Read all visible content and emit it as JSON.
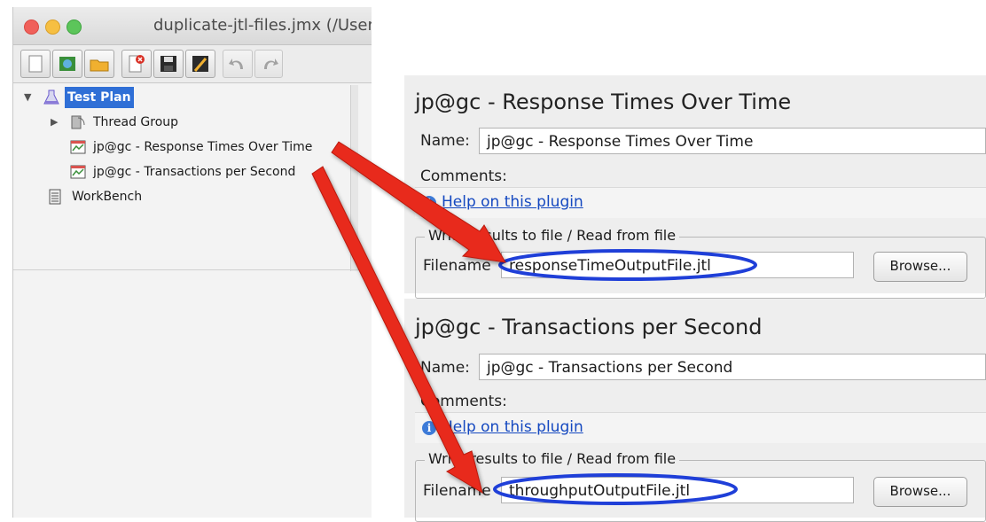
{
  "window": {
    "title": "duplicate-jtl-files.jmx (/User",
    "toolbar_icons": [
      "new-icon",
      "templates-icon",
      "open-icon",
      "close-icon",
      "save-icon",
      "save-as-icon",
      "undo-icon",
      "redo-icon"
    ]
  },
  "tree": {
    "items": [
      {
        "label": "Test Plan",
        "icon": "flask-icon",
        "selected": true
      },
      {
        "label": "Thread Group",
        "icon": "thread-group-icon"
      },
      {
        "label": "jp@gc - Response Times Over Time",
        "icon": "graph-listener-icon"
      },
      {
        "label": "jp@gc - Transactions per Second",
        "icon": "graph-listener-icon"
      },
      {
        "label": "WorkBench",
        "icon": "workbench-icon"
      }
    ]
  },
  "panels": [
    {
      "title": "jp@gc - Response Times Over Time",
      "name_label": "Name:",
      "name_value": "jp@gc - Response Times Over Time",
      "comments_label": "Comments:",
      "help_link": "Help on this plugin",
      "group_title": "Write results to file / Read from file",
      "filename_label": "Filename",
      "filename_value": "responseTimeOutputFile.jtl",
      "browse_label": "Browse..."
    },
    {
      "title": "jp@gc - Transactions per Second",
      "name_label": "Name:",
      "name_value": "jp@gc - Transactions per Second",
      "comments_label": "Comments:",
      "help_link": "Help on this plugin",
      "group_title": "Write results to file / Read from file",
      "filename_label": "Filename",
      "filename_value": "throughputOutputFile.jtl",
      "browse_label": "Browse..."
    }
  ],
  "colors": {
    "selection": "#2f6fd6",
    "arrow": "#e8291c",
    "highlight_ellipse": "#1f3fd8",
    "link": "#1448c0"
  }
}
